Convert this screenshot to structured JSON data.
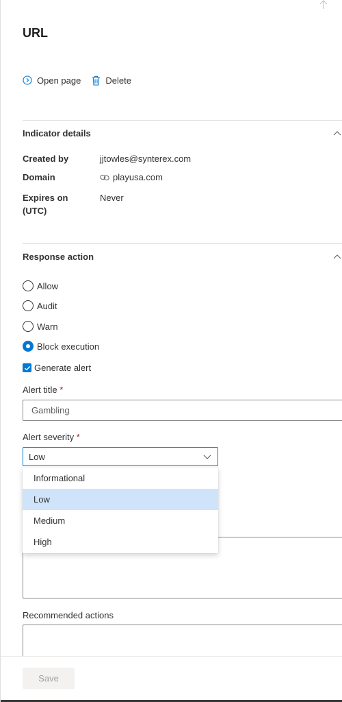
{
  "panel": {
    "title": "URL"
  },
  "commands": {
    "open_page": "Open page",
    "delete": "Delete"
  },
  "indicator_details": {
    "header": "Indicator details",
    "created_by_label": "Created by",
    "created_by_value": "jjtowles@synterex.com",
    "domain_label": "Domain",
    "domain_value": "playusa.com",
    "expires_label_line1": "Expires on",
    "expires_label_line2": "(UTC)",
    "expires_value": "Never"
  },
  "response_action": {
    "header": "Response action",
    "options": [
      {
        "label": "Allow",
        "selected": false
      },
      {
        "label": "Audit",
        "selected": false
      },
      {
        "label": "Warn",
        "selected": false
      },
      {
        "label": "Block execution",
        "selected": true
      }
    ],
    "generate_alert_label": "Generate alert",
    "generate_alert_checked": true
  },
  "alert": {
    "title_label": "Alert title",
    "title_value": "Gambling",
    "severity_label": "Alert severity",
    "required_marker": "*",
    "severity_value": "Low",
    "severity_options": [
      "Informational",
      "Low",
      "Medium",
      "High"
    ],
    "severity_selected": "Low"
  },
  "recommended_actions": {
    "label": "Recommended actions"
  },
  "footer": {
    "save_label": "Save"
  },
  "colors": {
    "accent": "#0078d4",
    "selected_option_bg": "#cfe4fa",
    "required": "#a4262c"
  }
}
